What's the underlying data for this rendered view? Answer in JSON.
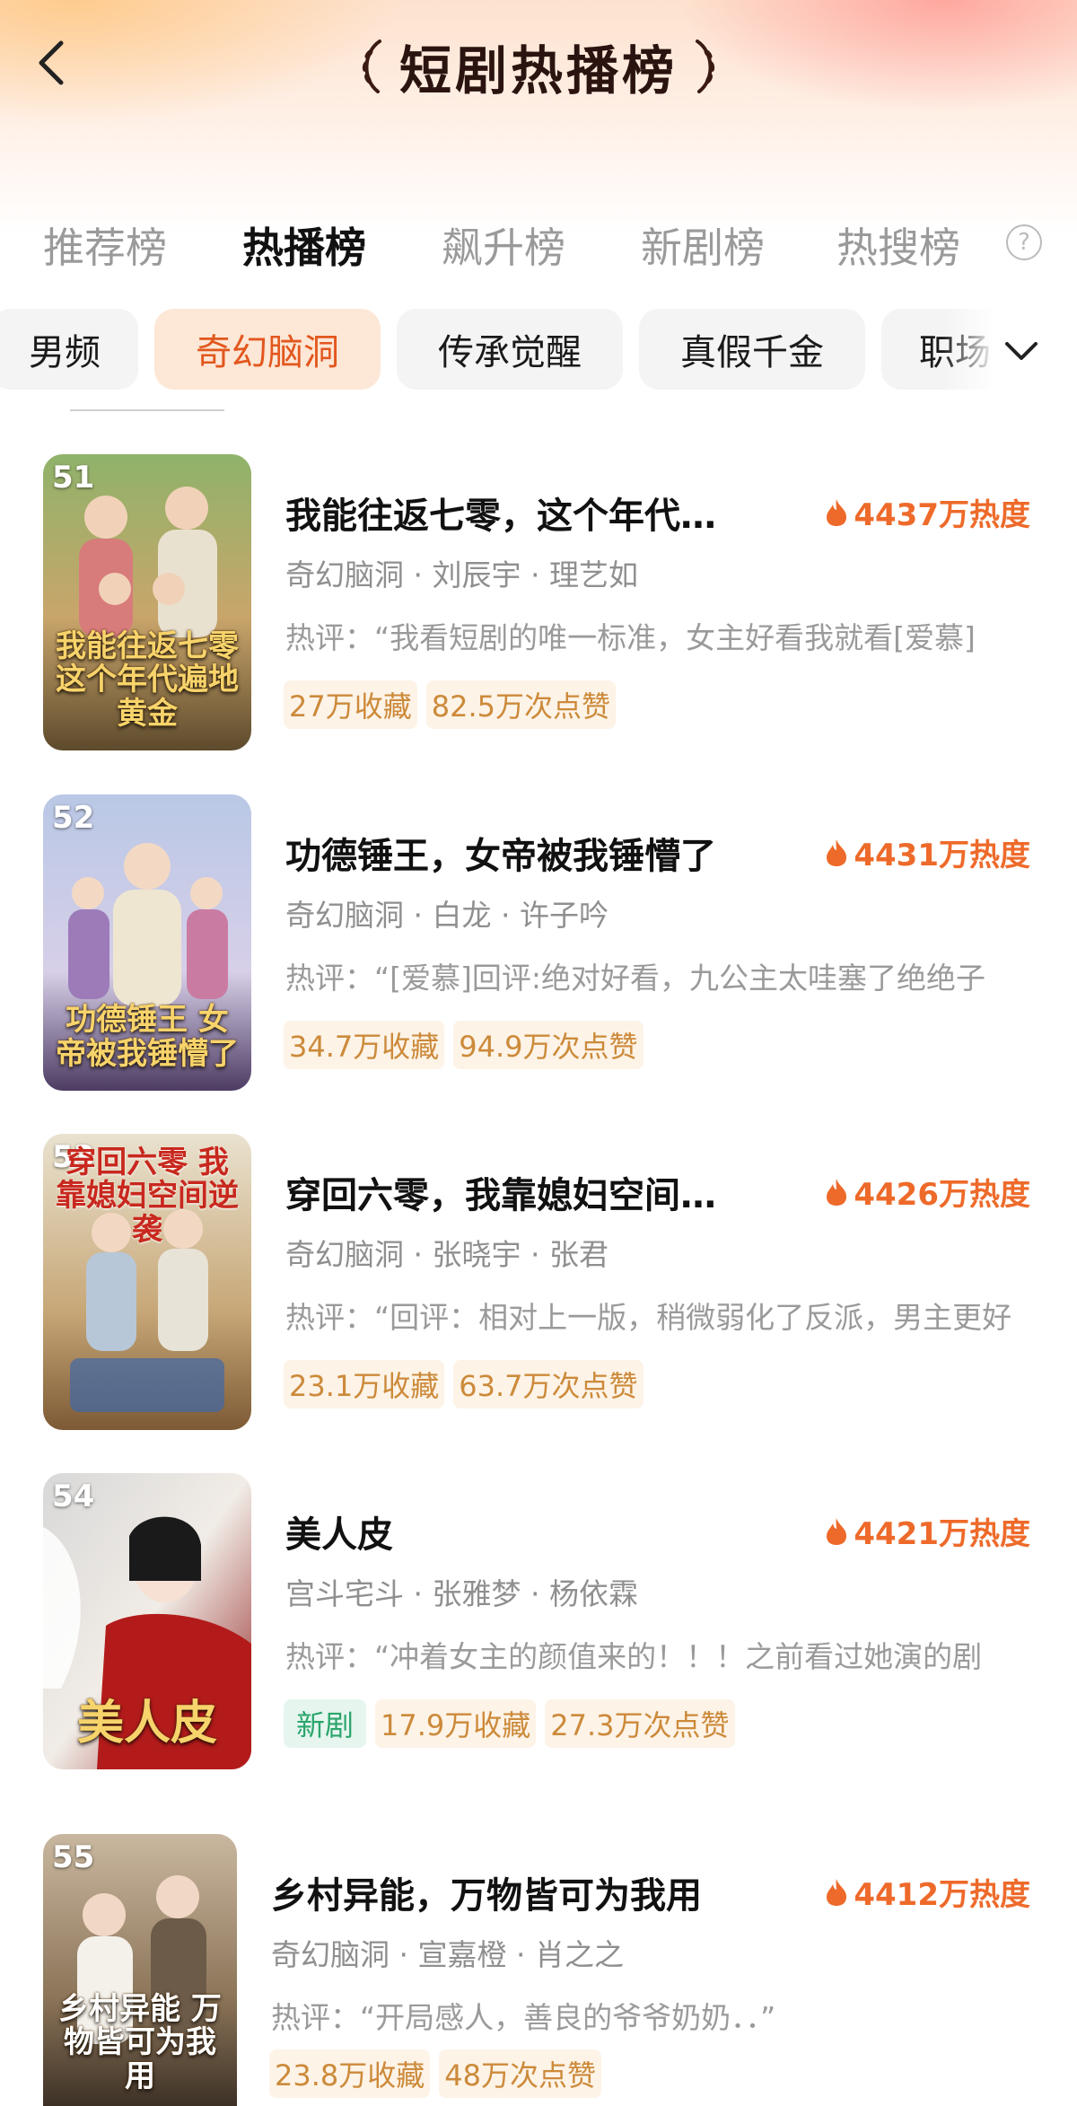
{
  "header": {
    "title": "短剧热播榜",
    "back_icon": "chevron-left-icon"
  },
  "tabs": [
    {
      "label": "推荐榜",
      "active": false
    },
    {
      "label": "热播榜",
      "active": true
    },
    {
      "label": "飙升榜",
      "active": false
    },
    {
      "label": "新剧榜",
      "active": false
    },
    {
      "label": "热搜榜",
      "active": false
    }
  ],
  "help_icon": "question-circle-icon",
  "chips": [
    {
      "label": "男频",
      "active": false
    },
    {
      "label": "奇幻脑洞",
      "active": true
    },
    {
      "label": "传承觉醒",
      "active": false
    },
    {
      "label": "真假千金",
      "active": false
    },
    {
      "label": "职场",
      "active": false
    }
  ],
  "chips_expand_icon": "chevron-down-icon",
  "colors": {
    "accent": "#ee6a2a",
    "chip_active_bg": "#fde7d6",
    "tag_bg": "#fdf3e7",
    "tag_text": "#cc8a3a",
    "new_tag_bg": "#e6f6ef",
    "new_tag_text": "#2aa56b"
  },
  "items": [
    {
      "rank": "51",
      "title": "我能往返七零，这个年代遍地黄金",
      "poster_text": "我能往返七零 这个年代遍地黄金",
      "heat": "4437万热度",
      "meta": "奇幻脑洞 · 刘辰宇 · 理艺如",
      "review": "热评：“我看短剧的唯一标准，女主好看我就看[爱慕]",
      "tags": [
        {
          "label": "27万收藏",
          "new": false
        },
        {
          "label": "82.5万次点赞",
          "new": false
        }
      ]
    },
    {
      "rank": "52",
      "title": "功德锤王，女帝被我锤懵了",
      "poster_text": "功德锤王 女帝被我锤懵了",
      "heat": "4431万热度",
      "meta": "奇幻脑洞 · 白龙 · 许子吟",
      "review": "热评：“[爱慕]回评:绝对好看，九公主太哇塞了绝绝子",
      "tags": [
        {
          "label": "34.7万收藏",
          "new": false
        },
        {
          "label": "94.9万次点赞",
          "new": false
        }
      ]
    },
    {
      "rank": "53",
      "title": "穿回六零，我靠媳妇空间逆袭",
      "poster_text": "穿回六零 我靠媳妇空间逆袭",
      "heat": "4426万热度",
      "meta": "奇幻脑洞 · 张晓宇 · 张君",
      "review": "热评：“回评：相对上一版，稍微弱化了反派，男主更好",
      "tags": [
        {
          "label": "23.1万收藏",
          "new": false
        },
        {
          "label": "63.7万次点赞",
          "new": false
        }
      ]
    },
    {
      "rank": "54",
      "title": "美人皮",
      "poster_text": "美人皮",
      "heat": "4421万热度",
      "meta": "宫斗宅斗 · 张雅梦 · 杨依霖",
      "review": "热评：“冲着女主的颜值来的！！！之前看过她演的剧",
      "tags": [
        {
          "label": "新剧",
          "new": true
        },
        {
          "label": "17.9万收藏",
          "new": false
        },
        {
          "label": "27.3万次点赞",
          "new": false
        }
      ]
    },
    {
      "rank": "55",
      "title": "乡村异能，万物皆可为我用",
      "poster_text": "乡村异能 万物皆可为我用",
      "heat": "4412万热度",
      "meta": "奇幻脑洞 · 宣嘉橙 · 肖之之",
      "review": "热评：“开局感人，善良的爷爷奶奶．．”",
      "tags": [
        {
          "label": "23.8万收藏",
          "new": false
        },
        {
          "label": "48万次点赞",
          "new": false
        }
      ]
    }
  ]
}
